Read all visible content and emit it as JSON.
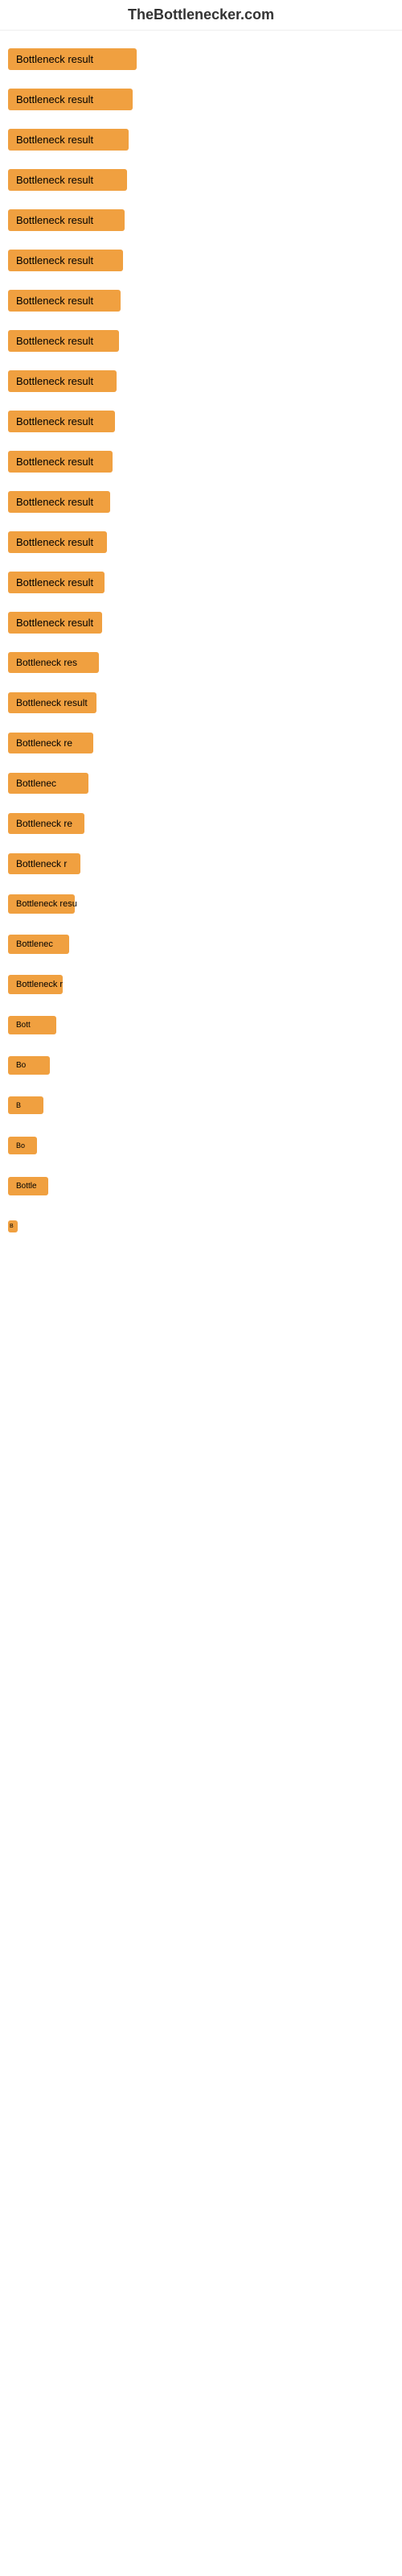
{
  "site": {
    "title": "TheBottlenecker.com"
  },
  "buttons": [
    {
      "id": 1,
      "label": "Bottleneck result",
      "size_class": "btn-size-1"
    },
    {
      "id": 2,
      "label": "Bottleneck result",
      "size_class": "btn-size-2"
    },
    {
      "id": 3,
      "label": "Bottleneck result",
      "size_class": "btn-size-3"
    },
    {
      "id": 4,
      "label": "Bottleneck result",
      "size_class": "btn-size-4"
    },
    {
      "id": 5,
      "label": "Bottleneck result",
      "size_class": "btn-size-5"
    },
    {
      "id": 6,
      "label": "Bottleneck result",
      "size_class": "btn-size-6"
    },
    {
      "id": 7,
      "label": "Bottleneck result",
      "size_class": "btn-size-7"
    },
    {
      "id": 8,
      "label": "Bottleneck result",
      "size_class": "btn-size-8"
    },
    {
      "id": 9,
      "label": "Bottleneck result",
      "size_class": "btn-size-9"
    },
    {
      "id": 10,
      "label": "Bottleneck result",
      "size_class": "btn-size-10"
    },
    {
      "id": 11,
      "label": "Bottleneck result",
      "size_class": "btn-size-11"
    },
    {
      "id": 12,
      "label": "Bottleneck result",
      "size_class": "btn-size-12"
    },
    {
      "id": 13,
      "label": "Bottleneck result",
      "size_class": "btn-size-13"
    },
    {
      "id": 14,
      "label": "Bottleneck result",
      "size_class": "btn-size-14"
    },
    {
      "id": 15,
      "label": "Bottleneck result",
      "size_class": "btn-size-15"
    },
    {
      "id": 16,
      "label": "Bottleneck res",
      "size_class": "btn-size-16"
    },
    {
      "id": 17,
      "label": "Bottleneck result",
      "size_class": "btn-size-17"
    },
    {
      "id": 18,
      "label": "Bottleneck re",
      "size_class": "btn-size-18"
    },
    {
      "id": 19,
      "label": "Bottlenec",
      "size_class": "btn-size-19"
    },
    {
      "id": 20,
      "label": "Bottleneck re",
      "size_class": "btn-size-20"
    },
    {
      "id": 21,
      "label": "Bottleneck r",
      "size_class": "btn-size-21"
    },
    {
      "id": 22,
      "label": "Bottleneck resu",
      "size_class": "btn-size-22"
    },
    {
      "id": 23,
      "label": "Bottlenec",
      "size_class": "btn-size-23"
    },
    {
      "id": 24,
      "label": "Bottleneck r",
      "size_class": "btn-size-24"
    },
    {
      "id": 25,
      "label": "Bott",
      "size_class": "btn-size-25"
    },
    {
      "id": 26,
      "label": "Bo",
      "size_class": "btn-size-26"
    },
    {
      "id": 27,
      "label": "B",
      "size_class": "btn-size-27"
    },
    {
      "id": 28,
      "label": "Bo",
      "size_class": "btn-size-28"
    },
    {
      "id": 29,
      "label": "Bottle",
      "size_class": "btn-size-32"
    },
    {
      "id": 30,
      "label": "B",
      "size_class": "btn-size-33"
    }
  ]
}
